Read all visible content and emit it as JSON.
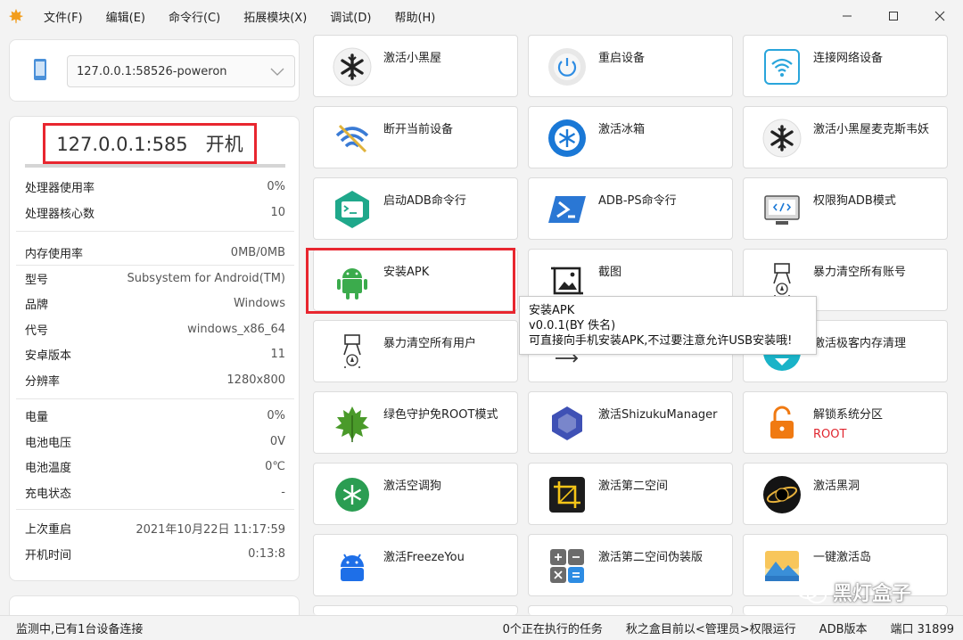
{
  "menu": [
    "文件(F)",
    "编辑(E)",
    "命令行(C)",
    "拓展模块(X)",
    "调试(D)",
    "帮助(H)"
  ],
  "device": {
    "selected": "127.0.0.1:58526-poweron"
  },
  "status_box": "127.0.0.1:585   开机",
  "info_groups": [
    [
      {
        "k": "处理器使用率",
        "v": "0%"
      },
      {
        "k": "处理器核心数",
        "v": "10"
      }
    ],
    [
      {
        "k": "内存使用率",
        "v": "0MB/0MB"
      },
      {
        "k": "型号",
        "v": "Subsystem for Android(TM)"
      },
      {
        "k": "品牌",
        "v": "Windows"
      },
      {
        "k": "代号",
        "v": "windows_x86_64"
      },
      {
        "k": "安卓版本",
        "v": "11"
      },
      {
        "k": "分辨率",
        "v": "1280x800"
      }
    ],
    [
      {
        "k": "电量",
        "v": "0%"
      },
      {
        "k": "电池电压",
        "v": "0V"
      },
      {
        "k": "电池温度",
        "v": "0℃"
      },
      {
        "k": "充电状态",
        "v": "-"
      }
    ],
    [
      {
        "k": "上次重启",
        "v": "2021年10月22日 11:17:59"
      },
      {
        "k": "开机时间",
        "v": "0:13:8"
      }
    ]
  ],
  "cards": [
    {
      "label": "激活小黑屋",
      "icon": "snowflake-dark-icon"
    },
    {
      "label": "重启设备",
      "icon": "power-icon"
    },
    {
      "label": "连接网络设备",
      "icon": "wifi-icon"
    },
    {
      "label": "断开当前设备",
      "icon": "wifi-off-icon"
    },
    {
      "label": "激活冰箱",
      "icon": "fridge-snowflake-icon"
    },
    {
      "label": "激活小黑屋麦克斯韦妖",
      "icon": "snowflake-dark-icon"
    },
    {
      "label": "启动ADB命令行",
      "icon": "terminal-icon"
    },
    {
      "label": "ADB-PS命令行",
      "icon": "powershell-icon"
    },
    {
      "label": "权限狗ADB模式",
      "icon": "monitor-code-icon"
    },
    {
      "label": "安装APK",
      "icon": "android-icon"
    },
    {
      "label": "截图",
      "icon": "screenshot-icon"
    },
    {
      "label": "暴力清空所有账号",
      "icon": "clear-clip-icon"
    },
    {
      "label": "暴力清空所有用户",
      "icon": "clear-clip-icon"
    },
    {
      "label": "",
      "icon": "swap-icon"
    },
    {
      "label": "激活极客内存清理",
      "icon": "memory-clean-icon"
    },
    {
      "label": "绿色守护免ROOT模式",
      "icon": "green-leaf-icon"
    },
    {
      "label": "激活ShizukuManager",
      "icon": "shizuku-icon"
    },
    {
      "label": "解锁系统分区",
      "sub": "ROOT",
      "icon": "unlock-icon"
    },
    {
      "label": "激活空调狗",
      "icon": "green-snowflake-icon"
    },
    {
      "label": "激活第二空间",
      "icon": "crop-icon"
    },
    {
      "label": "激活黑洞",
      "icon": "blackhole-icon"
    },
    {
      "label": "激活FreezeYou",
      "icon": "blue-android-icon"
    },
    {
      "label": "激活第二空间伪装版",
      "icon": "calculator-icon"
    },
    {
      "label": "一键激活岛",
      "icon": "island-icon"
    }
  ],
  "tooltip": {
    "line1": "安装APK",
    "line2": "v0.0.1(BY 佚名)",
    "line3": "可直接向手机安装APK,不过要注意允许USB安装哦!"
  },
  "status": {
    "left": "监测中,已有1台设备连接",
    "tasks": "0个正在执行的任务",
    "mode": "秋之盒目前以<管理员>权限运行",
    "adb": "ADB版本",
    "port": "端口 31899"
  },
  "watermark": "黑灯盒子",
  "colors": {
    "highlight": "#e8262f",
    "root_text": "#e0262f"
  }
}
